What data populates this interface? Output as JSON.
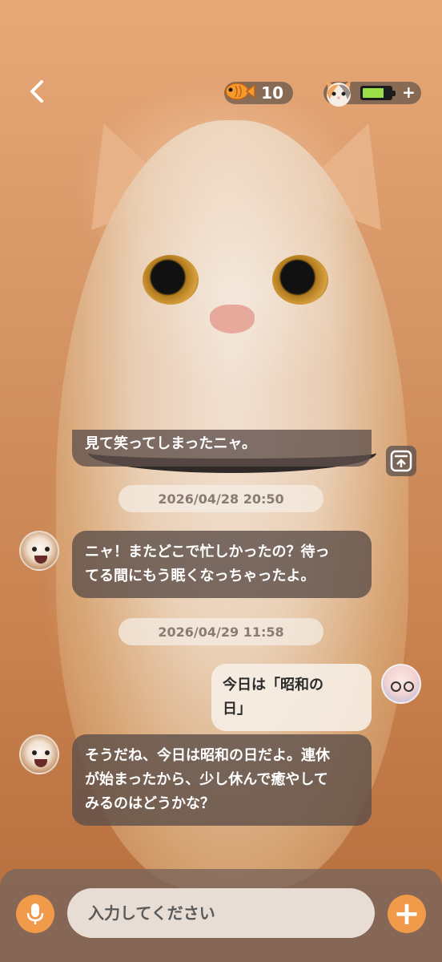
{
  "header": {
    "back_icon": "chevron-left-icon",
    "fish_icon": "fish-icon",
    "fish_count": "10",
    "pet_icon": "cat-head-icon",
    "battery_level": 0.75,
    "battery_color": "#9be04a",
    "add_label": "+"
  },
  "messages": {
    "partial_text": "見て笑ってしまったニャ。",
    "timestamp1": "2026/04/28 20:50",
    "cat_msg1_line1": "ニャ！またどこで忙しかったの？待っ",
    "cat_msg1_line2": "てる間にもう眠くなっちゃったよ。",
    "timestamp2": "2026/04/29 11:58",
    "user_msg_line1": "今日は「昭和の",
    "user_msg_line2": "日」",
    "cat_msg2_line1": "そうだね、今日は昭和の日だよ。連休",
    "cat_msg2_line2": "が始まったから、少し休んで癒やして",
    "cat_msg2_line3": "みるのはどうかな？"
  },
  "input": {
    "placeholder": "入力してください",
    "mic_icon": "microphone-icon",
    "add_label": "+"
  },
  "colors": {
    "accent": "#f19a4a",
    "bubble_dark": "#5f504b",
    "bubble_light": "#f6eee6"
  }
}
